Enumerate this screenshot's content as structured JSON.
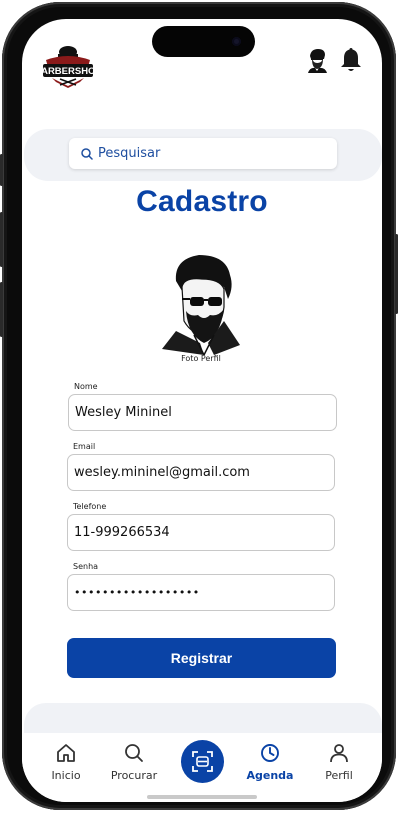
{
  "header": {
    "logo_text": "BARBERSHOP",
    "logo_icon": "barbershop-logo",
    "avatar_icon": "bearded-man-avatar-icon",
    "notification_icon": "bell-icon"
  },
  "search": {
    "placeholder": "Pesquisar",
    "icon": "search-icon"
  },
  "page": {
    "title": "Cadastro",
    "photo_caption": "Foto Perfil"
  },
  "form": {
    "nome": {
      "label": "Nome",
      "value": "Wesley Mininel"
    },
    "email": {
      "label": "Email",
      "value": "wesley.mininel@gmail.com"
    },
    "telefone": {
      "label": "Telefone",
      "value": "11-999266534"
    },
    "senha": {
      "label": "Senha",
      "value": "••••••••••••••••••"
    },
    "submit_label": "Registrar"
  },
  "tabbar": {
    "items": [
      {
        "label": "Inicio",
        "icon": "home-icon",
        "active": false
      },
      {
        "label": "Procurar",
        "icon": "search-icon",
        "active": false
      },
      {
        "label": "",
        "icon": "scan-face-icon",
        "active": false
      },
      {
        "label": "Agenda",
        "icon": "clock-icon",
        "active": true
      },
      {
        "label": "Perfil",
        "icon": "user-icon",
        "active": false
      }
    ]
  },
  "colors": {
    "brand_blue": "#0a43a6",
    "band_gray": "#f0f2f6",
    "frame": "#0b0b0b"
  }
}
